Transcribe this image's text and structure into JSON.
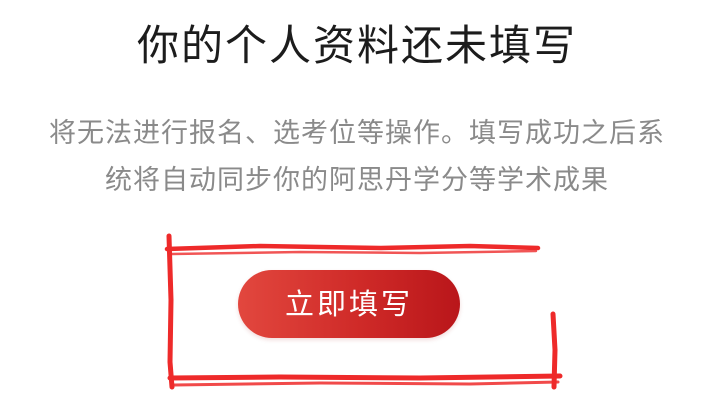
{
  "page": {
    "title": "你的个人资料还未填写",
    "description_line1": "将无法进行报名、选考位等操作。填写成功之后系",
    "description_line2": "统将自动同步你的阿思丹学分等学术成果",
    "primary_button_label": "立即填写"
  },
  "colors": {
    "title_text": "#1c1c1c",
    "description_text": "#8a8a8a",
    "button_gradient_start": "#e2473e",
    "button_gradient_end": "#b9161a",
    "annotation_stroke": "#ee2a2a"
  }
}
